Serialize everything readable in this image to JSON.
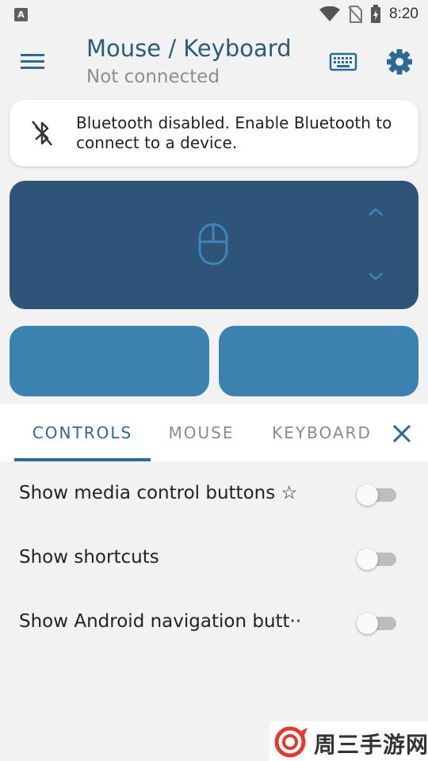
{
  "status_bar": {
    "app_icon_letter": "A",
    "time": "8:20",
    "icons": [
      "wifi-icon",
      "no-sim-icon",
      "battery-charging-icon"
    ]
  },
  "app_bar": {
    "title": "Mouse / Keyboard",
    "subtitle": "Not connected",
    "icons": [
      "menu-icon",
      "keyboard-icon",
      "gear-icon"
    ]
  },
  "bluetooth_card": {
    "message": "Bluetooth disabled. Enable Bluetooth to connect to a device.",
    "icon": "bluetooth-disabled-icon"
  },
  "touchpad": {
    "icon": "mouse-icon",
    "scroll_icons": [
      "chevron-up-icon",
      "chevron-down-icon"
    ]
  },
  "tabs": [
    {
      "label": "CONTROLS",
      "active": true
    },
    {
      "label": "MOUSE",
      "active": false
    },
    {
      "label": "KEYBOARD",
      "active": false
    }
  ],
  "settings": [
    {
      "label": "Show media control buttons ☆",
      "enabled": false
    },
    {
      "label": "Show shortcuts",
      "enabled": false
    },
    {
      "label": "Show Android navigation butt··",
      "enabled": false
    }
  ],
  "watermark": {
    "text": "周三手游网"
  },
  "colors": {
    "accent": "#2b6a97",
    "title": "#2b5a7c",
    "touchpad": "#2e5479",
    "mouse_button": "#3b82b1",
    "toggle_off_track": "#bdbdbd"
  }
}
